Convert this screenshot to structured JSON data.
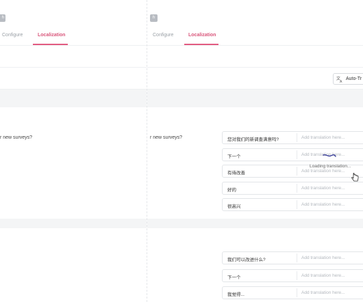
{
  "left_panel": {
    "tag": "h",
    "tabs": [
      {
        "label": "Configure"
      },
      {
        "label": "Localization"
      }
    ],
    "question": "r new surveys?"
  },
  "right_panel": {
    "tag": "h",
    "tabs": [
      {
        "label": "Configure"
      },
      {
        "label": "Localization"
      }
    ],
    "auto_translate_label": "Auto-Tr",
    "question": "r new surveys?",
    "loading_text": "Loading translation...",
    "translation_placeholder": "Add translation here...",
    "group1": [
      {
        "source": "您对我们的新调查满意吗?"
      },
      {
        "source": "下一个"
      },
      {
        "source": "有待改善"
      },
      {
        "source": "好的"
      },
      {
        "source": "很高兴"
      }
    ],
    "group2": [
      {
        "source": "我们可以改进什么?"
      },
      {
        "source": "下一个"
      },
      {
        "source": "我觉得..."
      }
    ]
  },
  "colors": {
    "accent": "#e25b80",
    "border": "#e2e5e8",
    "placeholder": "#b3b8be",
    "band": "#f4f5f6"
  }
}
